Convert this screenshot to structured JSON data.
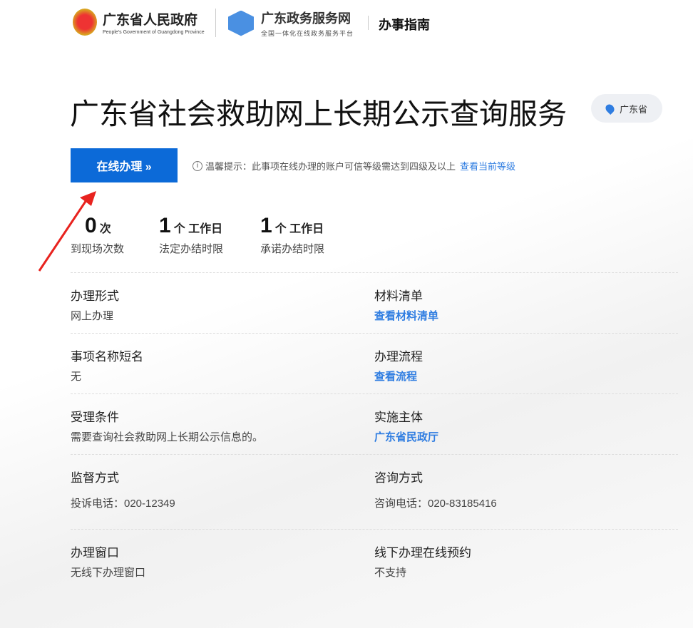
{
  "header": {
    "gov_title": "广东省人民政府",
    "gov_subtitle": "People's Government of Guangdong Province",
    "portal_title": "广东政务服务网",
    "portal_subtitle": "全国一体化在线政务服务平台",
    "section": "办事指南"
  },
  "page": {
    "title": "广东省社会救助网上长期公示查询服务",
    "region": "广东省"
  },
  "action": {
    "button": "在线办理 »",
    "tip": "温馨提示：此事项在线办理的账户可信等级需达到四级及以上",
    "tip_link": "查看当前等级"
  },
  "stats": [
    {
      "num": "0",
      "unit": "次",
      "label": "到现场次数"
    },
    {
      "num": "1",
      "unit": "个 工作日",
      "label": "法定办结时限"
    },
    {
      "num": "1",
      "unit": "个 工作日",
      "label": "承诺办结时限"
    }
  ],
  "details": [
    {
      "k": "办理形式",
      "v": "网上办理"
    },
    {
      "k": "材料清单",
      "v": "查看材料清单",
      "link": true
    },
    {
      "k": "事项名称短名",
      "v": "无"
    },
    {
      "k": "办理流程",
      "v": "查看流程",
      "link": true
    },
    {
      "k": "受理条件",
      "v": "需要查询社会救助网上长期公示信息的。"
    },
    {
      "k": "实施主体",
      "v": "广东省民政厅",
      "link": true
    },
    {
      "k": "监督方式",
      "v": "投诉电话：020-12349"
    },
    {
      "k": "咨询方式",
      "v": "咨询电话：020-83185416"
    },
    {
      "k": "办理窗口",
      "v": "无线下办理窗口"
    },
    {
      "k": "线下办理在线预约",
      "v": "不支持"
    }
  ]
}
